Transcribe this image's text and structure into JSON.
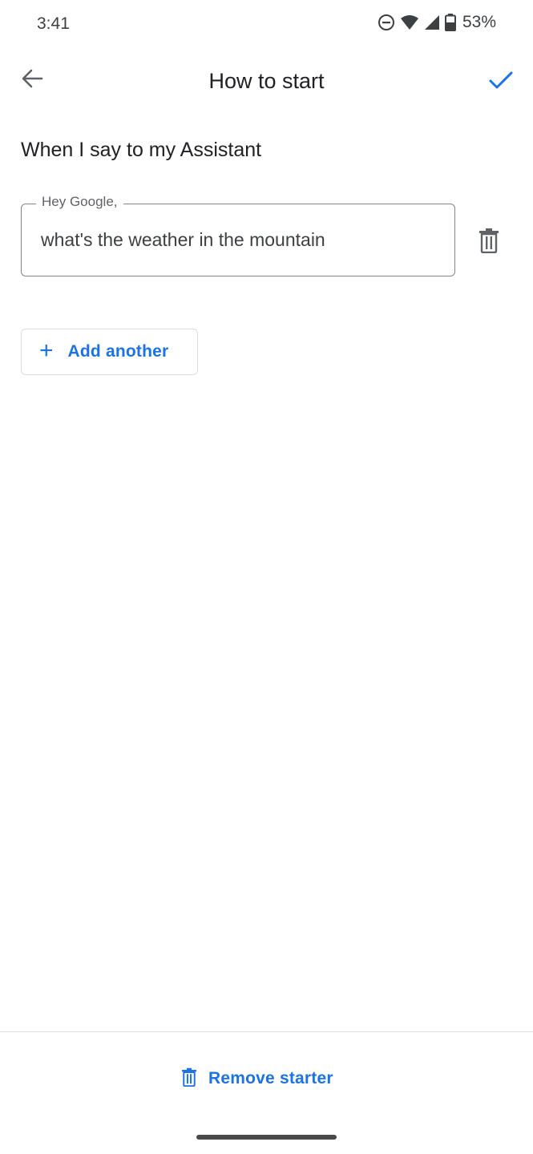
{
  "status_bar": {
    "time": "3:41",
    "battery_percent": "53%",
    "icons": [
      "do-not-disturb-icon",
      "wifi-icon",
      "cell-signal-icon",
      "battery-icon"
    ]
  },
  "app_bar": {
    "title": "How to start",
    "back_icon": "arrow-back-icon",
    "confirm_icon": "check-icon"
  },
  "section": {
    "label": "When I say to my Assistant"
  },
  "phrase_field": {
    "legend": "Hey Google,",
    "value": "what's the weather in the mountain"
  },
  "actions": {
    "add_another_label": "Add another",
    "remove_starter_label": "Remove starter"
  },
  "colors": {
    "accent": "#1a73e8",
    "text_primary": "#202124",
    "outline": "#80868b"
  }
}
